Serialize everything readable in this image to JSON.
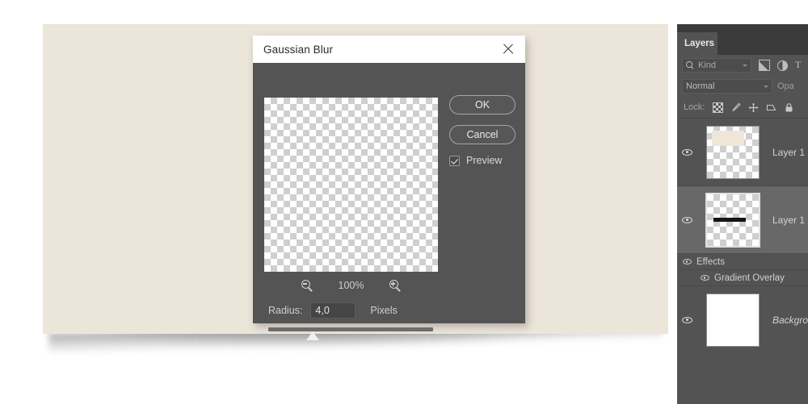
{
  "dialog": {
    "title": "Gaussian Blur",
    "close_icon": "close-icon",
    "ok_label": "OK",
    "cancel_label": "Cancel",
    "preview_label": "Preview",
    "preview_checked": true,
    "zoom_level": "100%",
    "zoom_out_icon": "zoom-out-icon",
    "zoom_in_icon": "zoom-in-icon",
    "radius_label": "Radius:",
    "radius_value": "4,0",
    "radius_units": "Pixels",
    "slider_position_pct": 27,
    "preview_thumbnail": "transparent-checkerboard"
  },
  "layers_panel": {
    "tab_label": "Layers",
    "filter": {
      "search_icon": "search-icon",
      "kind_label": "Kind",
      "icons": [
        "image-filter-icon",
        "adjustment-filter-icon",
        "type-filter-icon"
      ]
    },
    "blend": {
      "mode": "Normal",
      "opacity_label": "Opa"
    },
    "lock": {
      "label": "Lock:",
      "icons": [
        "lock-transparency-icon",
        "lock-pixels-brush-icon",
        "lock-position-move-icon",
        "lock-artboard-icon",
        "lock-all-icon"
      ]
    },
    "layers": [
      {
        "name": "Layer 1",
        "visible": true,
        "selected": false,
        "thumbnail": "checkerboard-with-beige-block",
        "effects": []
      },
      {
        "name": "Layer 1",
        "visible": true,
        "selected": true,
        "thumbnail": "checkerboard-with-black-bar",
        "effects": [
          {
            "label": "Effects",
            "visible": true
          },
          {
            "label": "Gradient Overlay",
            "visible": true
          }
        ]
      },
      {
        "name": "Background",
        "visible": true,
        "selected": false,
        "italic": true,
        "thumbnail": "white",
        "effects": []
      }
    ]
  },
  "colors": {
    "canvas_background": "#ece5da",
    "dialog_background": "#545454",
    "panel_background": "#535353",
    "panel_selected": "#686868",
    "page_background": "#ffffff"
  }
}
